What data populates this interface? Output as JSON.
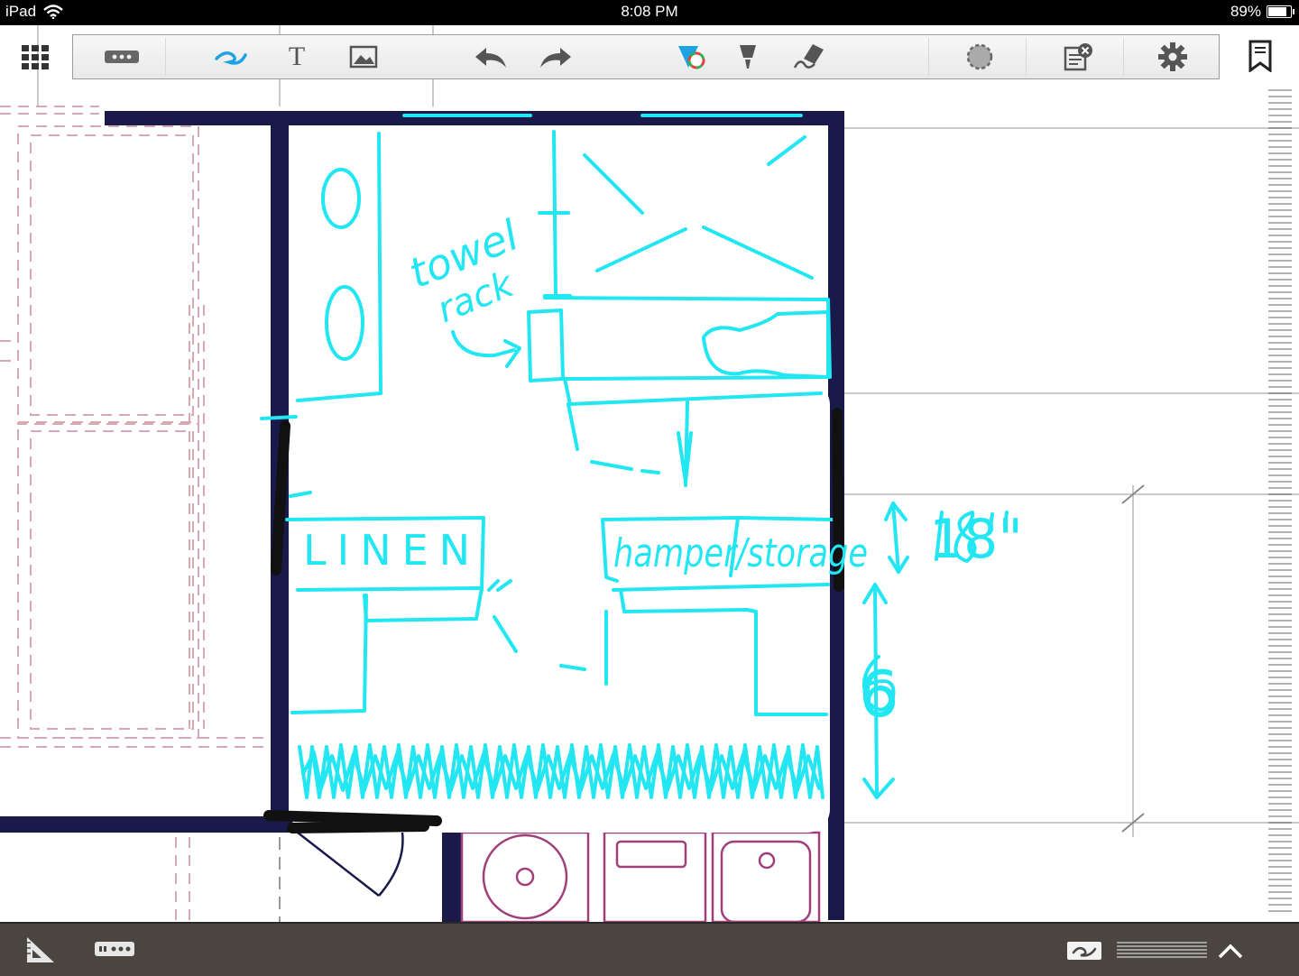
{
  "status_bar": {
    "device": "iPad",
    "time": "8:08 PM",
    "battery": "89%",
    "battery_level": 0.89
  },
  "toolbar": {
    "icons": [
      "apps-grid-icon",
      "more-icon",
      "pen-tool-icon",
      "text-tool-icon",
      "image-tool-icon",
      "undo-icon",
      "redo-icon",
      "color-picker-icon",
      "highlighter-icon",
      "eraser-icon",
      "lasso-icon",
      "clear-page-icon",
      "settings-icon",
      "bookmark-icon"
    ],
    "text_tool_glyph": "T"
  },
  "drawing": {
    "ink_color": "#22e6f2",
    "marker_color": "#111111",
    "wall_color": "#1a1a4a",
    "labels": {
      "towel": "towel",
      "rack": "rack",
      "linen": "LINEN",
      "hamper_storage": "hamper/storage",
      "dim_18": "18\"",
      "dim_6": "6"
    }
  },
  "bottom_bar": {
    "icons": [
      "ruler-triangle-icon",
      "keyboard-icon",
      "handwriting-icon",
      "lines-icon",
      "chevron-up-icon"
    ]
  }
}
